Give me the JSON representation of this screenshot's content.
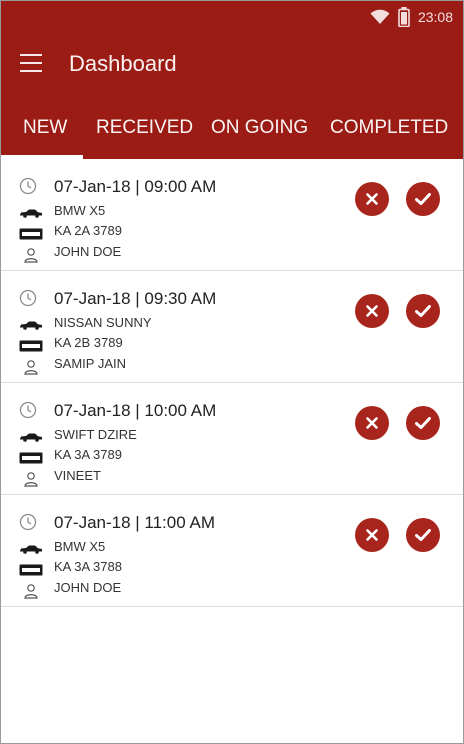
{
  "status_bar": {
    "time": "23:08"
  },
  "app_bar": {
    "title": "Dashboard"
  },
  "tabs": [
    {
      "label": "NEW",
      "active": true
    },
    {
      "label": "RECEIVED",
      "active": false
    },
    {
      "label": "ON GOING",
      "active": false
    },
    {
      "label": "COMPLETED",
      "active": false
    }
  ],
  "bookings": [
    {
      "datetime": "07-Jan-18 | 09:00 AM",
      "car": "BMW X5",
      "plate": "KA 2A 3789",
      "customer": "JOHN DOE"
    },
    {
      "datetime": "07-Jan-18 | 09:30 AM",
      "car": "NISSAN SUNNY",
      "plate": "KA 2B 3789",
      "customer": "SAMIP JAIN"
    },
    {
      "datetime": "07-Jan-18 | 10:00 AM",
      "car": "SWIFT DZIRE",
      "plate": "KA 3A 3789",
      "customer": "VINEET"
    },
    {
      "datetime": "07-Jan-18 | 11:00 AM",
      "car": "BMW X5",
      "plate": "KA 3A 3788",
      "customer": "JOHN DOE"
    }
  ],
  "colors": {
    "primary": "#9b1c14",
    "action": "#a8251e",
    "divider": "#dcdcdc"
  },
  "icons": [
    "wifi-icon",
    "battery-icon",
    "menu-icon",
    "clock-icon",
    "car-icon",
    "plate-icon",
    "user-icon",
    "close-icon",
    "check-icon"
  ]
}
